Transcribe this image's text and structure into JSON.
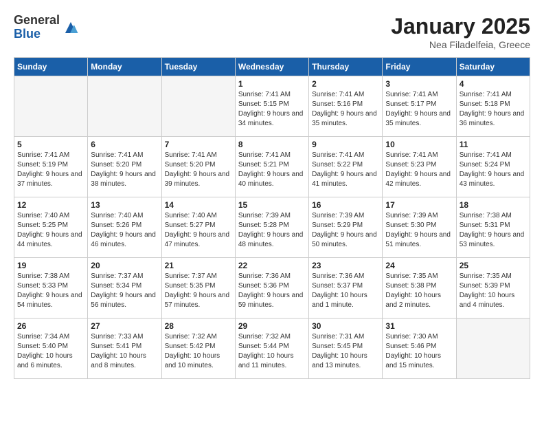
{
  "header": {
    "logo_general": "General",
    "logo_blue": "Blue",
    "month_title": "January 2025",
    "location": "Nea Filadelfeia, Greece"
  },
  "weekdays": [
    "Sunday",
    "Monday",
    "Tuesday",
    "Wednesday",
    "Thursday",
    "Friday",
    "Saturday"
  ],
  "weeks": [
    [
      {
        "day": "",
        "empty": true
      },
      {
        "day": "",
        "empty": true
      },
      {
        "day": "",
        "empty": true
      },
      {
        "day": "1",
        "sunrise": "7:41 AM",
        "sunset": "5:15 PM",
        "daylight": "9 hours and 34 minutes."
      },
      {
        "day": "2",
        "sunrise": "7:41 AM",
        "sunset": "5:16 PM",
        "daylight": "9 hours and 35 minutes."
      },
      {
        "day": "3",
        "sunrise": "7:41 AM",
        "sunset": "5:17 PM",
        "daylight": "9 hours and 35 minutes."
      },
      {
        "day": "4",
        "sunrise": "7:41 AM",
        "sunset": "5:18 PM",
        "daylight": "9 hours and 36 minutes."
      }
    ],
    [
      {
        "day": "5",
        "sunrise": "7:41 AM",
        "sunset": "5:19 PM",
        "daylight": "9 hours and 37 minutes."
      },
      {
        "day": "6",
        "sunrise": "7:41 AM",
        "sunset": "5:20 PM",
        "daylight": "9 hours and 38 minutes."
      },
      {
        "day": "7",
        "sunrise": "7:41 AM",
        "sunset": "5:20 PM",
        "daylight": "9 hours and 39 minutes."
      },
      {
        "day": "8",
        "sunrise": "7:41 AM",
        "sunset": "5:21 PM",
        "daylight": "9 hours and 40 minutes."
      },
      {
        "day": "9",
        "sunrise": "7:41 AM",
        "sunset": "5:22 PM",
        "daylight": "9 hours and 41 minutes."
      },
      {
        "day": "10",
        "sunrise": "7:41 AM",
        "sunset": "5:23 PM",
        "daylight": "9 hours and 42 minutes."
      },
      {
        "day": "11",
        "sunrise": "7:41 AM",
        "sunset": "5:24 PM",
        "daylight": "9 hours and 43 minutes."
      }
    ],
    [
      {
        "day": "12",
        "sunrise": "7:40 AM",
        "sunset": "5:25 PM",
        "daylight": "9 hours and 44 minutes."
      },
      {
        "day": "13",
        "sunrise": "7:40 AM",
        "sunset": "5:26 PM",
        "daylight": "9 hours and 46 minutes."
      },
      {
        "day": "14",
        "sunrise": "7:40 AM",
        "sunset": "5:27 PM",
        "daylight": "9 hours and 47 minutes."
      },
      {
        "day": "15",
        "sunrise": "7:39 AM",
        "sunset": "5:28 PM",
        "daylight": "9 hours and 48 minutes."
      },
      {
        "day": "16",
        "sunrise": "7:39 AM",
        "sunset": "5:29 PM",
        "daylight": "9 hours and 50 minutes."
      },
      {
        "day": "17",
        "sunrise": "7:39 AM",
        "sunset": "5:30 PM",
        "daylight": "9 hours and 51 minutes."
      },
      {
        "day": "18",
        "sunrise": "7:38 AM",
        "sunset": "5:31 PM",
        "daylight": "9 hours and 53 minutes."
      }
    ],
    [
      {
        "day": "19",
        "sunrise": "7:38 AM",
        "sunset": "5:33 PM",
        "daylight": "9 hours and 54 minutes."
      },
      {
        "day": "20",
        "sunrise": "7:37 AM",
        "sunset": "5:34 PM",
        "daylight": "9 hours and 56 minutes."
      },
      {
        "day": "21",
        "sunrise": "7:37 AM",
        "sunset": "5:35 PM",
        "daylight": "9 hours and 57 minutes."
      },
      {
        "day": "22",
        "sunrise": "7:36 AM",
        "sunset": "5:36 PM",
        "daylight": "9 hours and 59 minutes."
      },
      {
        "day": "23",
        "sunrise": "7:36 AM",
        "sunset": "5:37 PM",
        "daylight": "10 hours and 1 minute."
      },
      {
        "day": "24",
        "sunrise": "7:35 AM",
        "sunset": "5:38 PM",
        "daylight": "10 hours and 2 minutes."
      },
      {
        "day": "25",
        "sunrise": "7:35 AM",
        "sunset": "5:39 PM",
        "daylight": "10 hours and 4 minutes."
      }
    ],
    [
      {
        "day": "26",
        "sunrise": "7:34 AM",
        "sunset": "5:40 PM",
        "daylight": "10 hours and 6 minutes."
      },
      {
        "day": "27",
        "sunrise": "7:33 AM",
        "sunset": "5:41 PM",
        "daylight": "10 hours and 8 minutes."
      },
      {
        "day": "28",
        "sunrise": "7:32 AM",
        "sunset": "5:42 PM",
        "daylight": "10 hours and 10 minutes."
      },
      {
        "day": "29",
        "sunrise": "7:32 AM",
        "sunset": "5:44 PM",
        "daylight": "10 hours and 11 minutes."
      },
      {
        "day": "30",
        "sunrise": "7:31 AM",
        "sunset": "5:45 PM",
        "daylight": "10 hours and 13 minutes."
      },
      {
        "day": "31",
        "sunrise": "7:30 AM",
        "sunset": "5:46 PM",
        "daylight": "10 hours and 15 minutes."
      },
      {
        "day": "",
        "empty": true
      }
    ]
  ]
}
